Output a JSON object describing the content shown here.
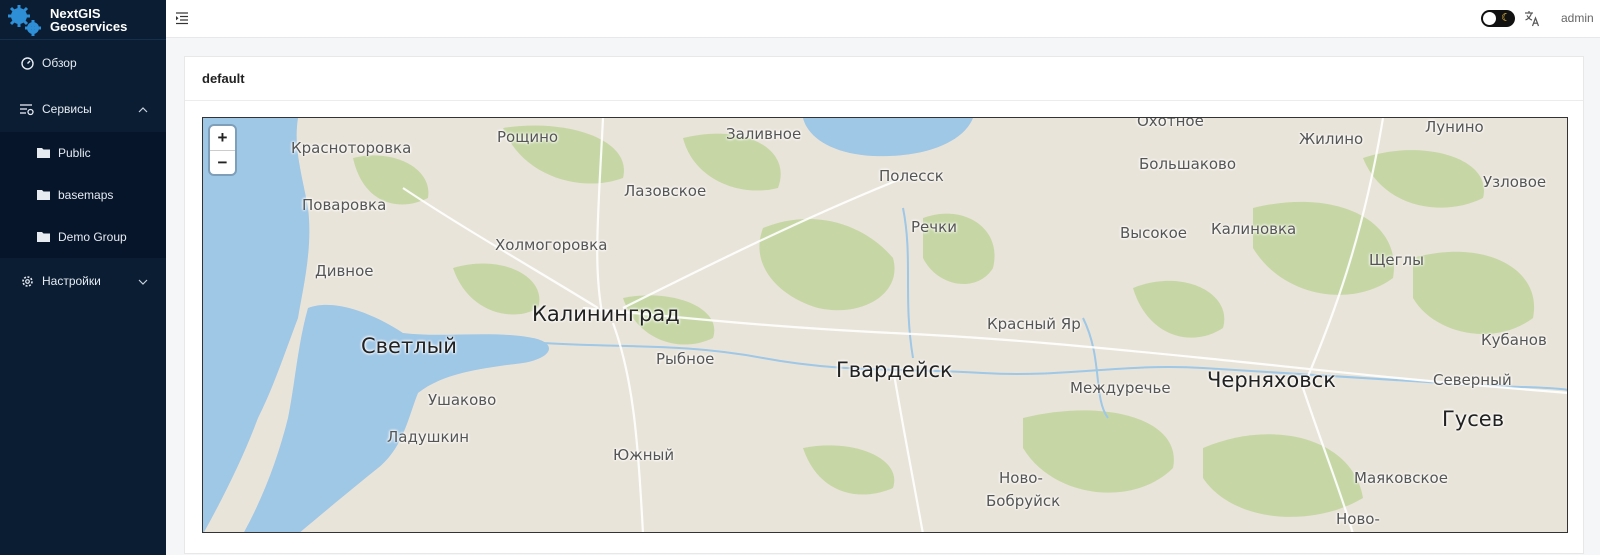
{
  "brand": {
    "line1": "NextGIS",
    "line2": "Geoservices"
  },
  "sidebar": {
    "items": [
      {
        "label": "Обзор"
      },
      {
        "label": "Сервисы"
      },
      {
        "label": "Настройки"
      }
    ],
    "sub_items": [
      {
        "label": "Public"
      },
      {
        "label": "basemaps"
      },
      {
        "label": "Demo Group"
      }
    ]
  },
  "header": {
    "user": "admin"
  },
  "card": {
    "title": "default"
  },
  "map": {
    "zoom_in": "+",
    "zoom_out": "−",
    "places": [
      "Охотное",
      "Лунино",
      "Жилино",
      "Рощино",
      "Заливное",
      "Красноторовка",
      "Большаково",
      "Полесск",
      "Узловое",
      "Лазовское",
      "Поваровка",
      "Речки",
      "Высокое",
      "Калиновка",
      "Холмогоровка",
      "Щеглы",
      "Дивное",
      "Калининград",
      "Красный Яр",
      "Кубанов",
      "Светлый",
      "Рыбное",
      "Гвардейск",
      "Черняховск",
      "Северный",
      "Междуречье",
      "Ушаково",
      "Гусев",
      "Ладушкин",
      "Южный",
      "Ново-",
      "Маяковское",
      "Бобруйск",
      "Ново-"
    ]
  },
  "colors": {
    "sidebar_bg": "#0b1d33",
    "water": "#9fc7e6",
    "land": "#e9e4d9",
    "forest": "#c6d7a5"
  }
}
